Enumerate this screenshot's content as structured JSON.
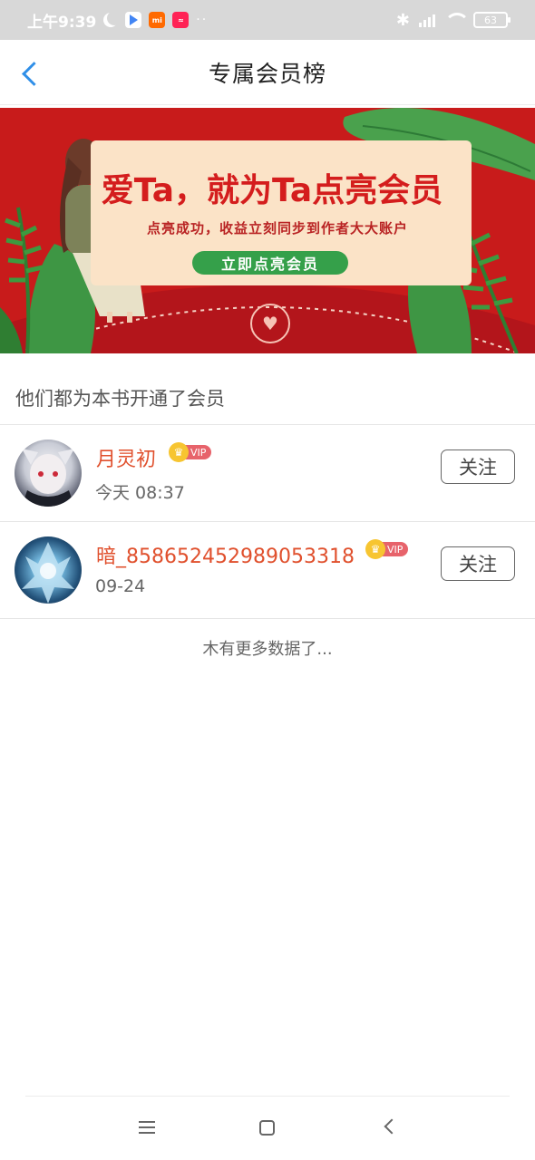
{
  "status_bar": {
    "time": "上午9:39",
    "dots": "··",
    "battery": "63",
    "network_label": "HD",
    "app_icons": [
      "play-store-icon",
      "mi-app-icon",
      "weibo-app-icon"
    ]
  },
  "header": {
    "title": "专属会员榜"
  },
  "banner": {
    "headline": "爱Ta，就为Ta点亮会员",
    "subline": "点亮成功，收益立刻同步到作者大大账户",
    "cta": "立即点亮会员"
  },
  "section": {
    "label": "他们都为本书开通了会员"
  },
  "members": [
    {
      "name": "月灵初",
      "vip": "VIP",
      "time": "今天 08:37",
      "follow": "关注"
    },
    {
      "name": "暗_858652452989053318",
      "vip": "VIP",
      "time": "09-24",
      "follow": "关注"
    }
  ],
  "footer": {
    "no_more": "木有更多数据了..."
  },
  "colors": {
    "accent_blue": "#2f8fe8",
    "name_red": "#e0502d",
    "banner_red": "#c81b1b",
    "vip_pink": "#e7636b",
    "crown_gold": "#f7c531"
  }
}
